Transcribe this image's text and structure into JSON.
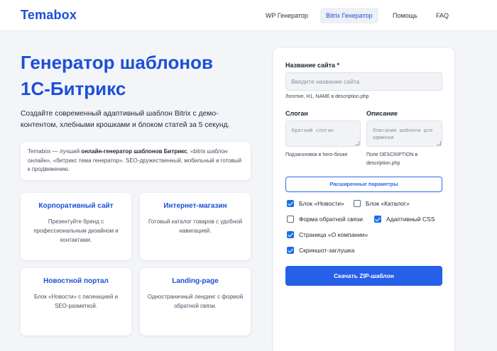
{
  "header": {
    "logo": "Temabox",
    "nav": [
      {
        "label": "WP Генератор",
        "active": false
      },
      {
        "label": "Bitrix Генератор",
        "active": true
      },
      {
        "label": "Помощь",
        "active": false
      },
      {
        "label": "FAQ",
        "active": false
      }
    ]
  },
  "hero": {
    "title": "Генератор шаблонов 1С-Битрикс",
    "subtitle": "Создайте современный адаптивный шаблон Bitrix с демо-контентом, хлебными крошками и блоком статей за 5 секунд."
  },
  "info": {
    "prefix": "Temabox — лучший ",
    "bold": "онлайн-генератор шаблонов Битрикс",
    "suffix": ", «bitrix шаблон онлайн», «битрикс тема генератор». SEO-дружественный, мобильный и готовый к продвижению."
  },
  "features": [
    {
      "title": "Корпоративный сайт",
      "text": "Презентуйте бренд с профессиональным дизайном и контактами."
    },
    {
      "title": "Интернет-магазин",
      "text": "Готовый каталог товаров с удобной навигацией."
    },
    {
      "title": "Новостной портал",
      "text": "Блок «Новости» с пагинацией и SEO-разметкой."
    },
    {
      "title": "Landing-page",
      "text": "Одностраничный лендинг с формой обратной связи."
    }
  ],
  "form": {
    "site_name_label": "Название сайта *",
    "site_name_placeholder": "Введите название сайта",
    "site_name_value": "",
    "site_name_hint": "Логотип, H1, NAME в description.php",
    "slogan_label": "Слоган",
    "slogan_placeholder": "Краткий слоган",
    "slogan_hint": "Подзаголовок в hero-блоке",
    "description_label": "Описание",
    "description_placeholder": "Описание шаблона для админки",
    "description_hint": "Поле DESCRIPTION в description.php",
    "advanced_button": "Расширенные параметры",
    "options": [
      {
        "label": "Блок «Новости»",
        "checked": true
      },
      {
        "label": "Блок «Каталог»",
        "checked": false
      },
      {
        "label": "Форма обратной связи",
        "checked": false
      },
      {
        "label": "Адаптивный CSS",
        "checked": true
      },
      {
        "label": "Страница «О компании»",
        "checked": true
      },
      {
        "label": "Скриншот-заглушка",
        "checked": true
      }
    ],
    "submit_button": "Скачать ZIP-шаблон"
  },
  "colors": {
    "accent": "#1d4fd8",
    "button": "#2660e8",
    "background": "#f3f5f9"
  }
}
